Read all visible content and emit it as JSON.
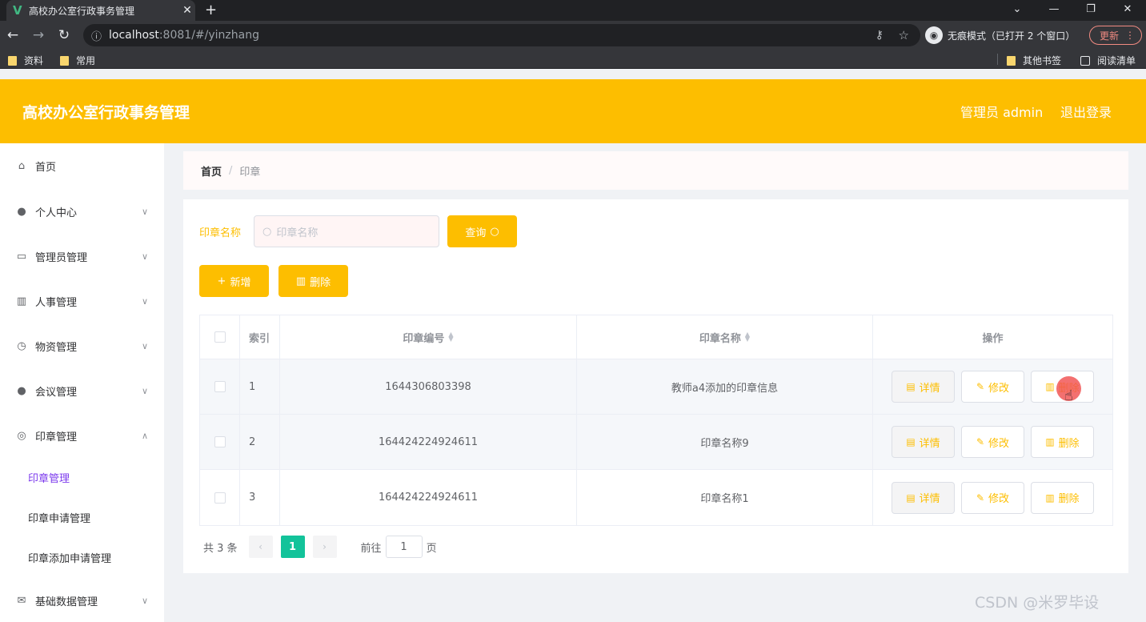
{
  "browser": {
    "tab_title": "高校办公室行政事务管理",
    "tab_logo": "V",
    "url_host": "localhost",
    "url_path": ":8081/#/yinzhang",
    "incognito_label": "无痕模式（已打开 2 个窗口）",
    "update_label": "更新",
    "bookmarks": [
      "资料",
      "常用"
    ],
    "other_bookmarks": "其他书签",
    "reading_list": "阅读清单"
  },
  "header": {
    "title": "高校办公室行政事务管理",
    "user": "管理员 admin",
    "logout": "退出登录"
  },
  "sidebar": {
    "items": [
      {
        "label": "首页"
      },
      {
        "label": "个人中心"
      },
      {
        "label": "管理员管理"
      },
      {
        "label": "人事管理"
      },
      {
        "label": "物资管理"
      },
      {
        "label": "会议管理"
      },
      {
        "label": "印章管理"
      },
      {
        "label": "基础数据管理"
      }
    ],
    "subitems": [
      {
        "label": "印章管理",
        "active": true
      },
      {
        "label": "印章申请管理"
      },
      {
        "label": "印章添加申请管理"
      }
    ]
  },
  "breadcrumb": {
    "home": "首页",
    "separator": "/",
    "current": "印章"
  },
  "filter": {
    "label": "印章名称",
    "placeholder": "印章名称",
    "query_button": "查询"
  },
  "actions": {
    "add": "新增",
    "delete": "删除"
  },
  "table": {
    "headers": {
      "index": "索引",
      "code": "印章编号",
      "name": "印章名称",
      "ops": "操作"
    },
    "rows": [
      {
        "index": "1",
        "code": "1644306803398",
        "name": "教师a4添加的印章信息"
      },
      {
        "index": "2",
        "code": "164424224924611",
        "name": "印章名称9"
      },
      {
        "index": "3",
        "code": "164424224924611",
        "name": "印章名称1"
      }
    ],
    "op_labels": {
      "detail": "详情",
      "edit": "修改",
      "delete": "删除"
    }
  },
  "pagination": {
    "total": "共 3 条",
    "current_page": "1",
    "goto_prefix": "前往",
    "goto_value": "1",
    "goto_suffix": "页"
  },
  "watermark": "CSDN @米罗毕设",
  "colors": {
    "accent": "#fdbe00",
    "page_active": "#13c39a",
    "submenu_active": "#7c3aed"
  }
}
